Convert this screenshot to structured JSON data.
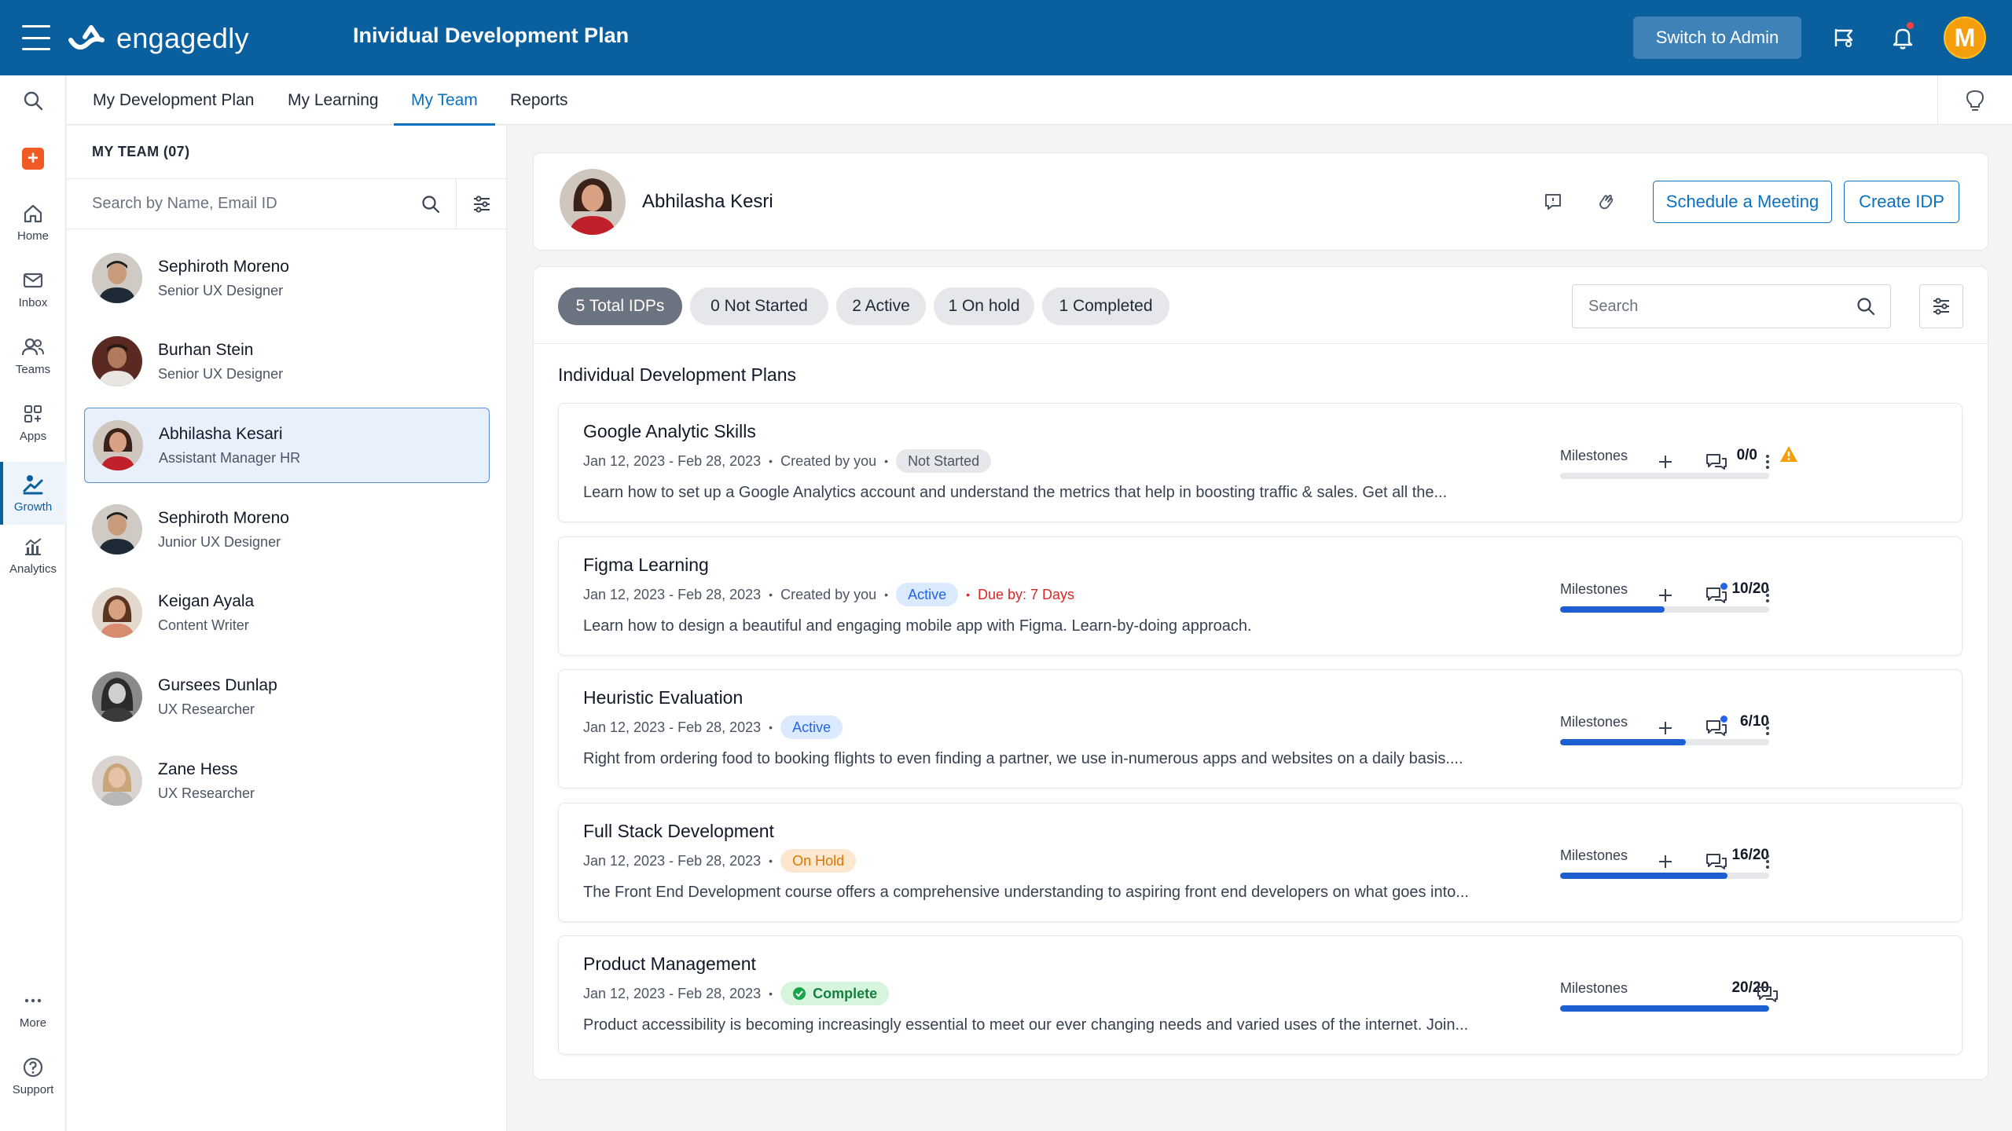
{
  "app": {
    "brand": "engagedly",
    "title": "Inividual Development Plan",
    "switch_admin": "Switch to Admin",
    "user_initial": "M"
  },
  "rail": {
    "items": [
      {
        "label": "Home"
      },
      {
        "label": "Inbox"
      },
      {
        "label": "Teams"
      },
      {
        "label": "Apps"
      },
      {
        "label": "Growth"
      },
      {
        "label": "Analytics"
      },
      {
        "label": "More"
      },
      {
        "label": "Support"
      }
    ]
  },
  "tabs": [
    {
      "label": "My Development Plan"
    },
    {
      "label": "My Learning"
    },
    {
      "label": "My Team"
    },
    {
      "label": "Reports"
    }
  ],
  "team": {
    "header": "MY TEAM (07)",
    "search_placeholder": "Search by Name, Email ID",
    "members": [
      {
        "name": "Sephiroth Moreno",
        "role": "Senior UX Designer"
      },
      {
        "name": "Burhan Stein",
        "role": "Senior UX Designer"
      },
      {
        "name": "Abhilasha Kesari",
        "role": "Assistant Manager HR"
      },
      {
        "name": "Sephiroth Moreno",
        "role": "Junior UX Designer"
      },
      {
        "name": "Keigan Ayala",
        "role": "Content Writer"
      },
      {
        "name": "Gursees Dunlap",
        "role": "UX Researcher"
      },
      {
        "name": "Zane Hess",
        "role": "UX Researcher"
      }
    ]
  },
  "person": {
    "name": "Abhilasha Kesri",
    "schedule_label": "Schedule a Meeting",
    "create_label": "Create IDP"
  },
  "filters": {
    "chips": [
      {
        "label": "5 Total IDPs"
      },
      {
        "label": "0 Not Started"
      },
      {
        "label": "2 Active"
      },
      {
        "label": "1 On hold"
      },
      {
        "label": "1 Completed"
      }
    ],
    "search_placeholder": "Search"
  },
  "plans_title": "Individual Development Plans",
  "plans": [
    {
      "title": "Google Analytic Skills",
      "dates": "Jan 12, 2023 - Feb 28, 2023",
      "created": "Created by you",
      "status": "Not Started",
      "due": "",
      "desc": "Learn how to set up a Google Analytics account and understand the metrics that help in boosting traffic & sales. Get all the...",
      "milestones_label": "Milestones",
      "milestones": "0/0",
      "progress": 0
    },
    {
      "title": "Figma Learning",
      "dates": "Jan 12, 2023 - Feb 28, 2023",
      "created": "Created by you",
      "status": "Active",
      "due": "Due by: 7 Days",
      "desc": "Learn how to design a beautiful and engaging mobile app with Figma. Learn-by-doing approach.",
      "milestones_label": "Milestones",
      "milestones": "10/20",
      "progress": 0.5
    },
    {
      "title": "Heuristic Evaluation",
      "dates": "Jan 12, 2023 - Feb 28, 2023",
      "created": "",
      "status": "Active",
      "due": "",
      "desc": "Right from ordering food to booking flights to even finding a partner, we use in-numerous apps and websites on a daily basis....",
      "milestones_label": "Milestones",
      "milestones": "6/10",
      "progress": 0.6
    },
    {
      "title": "Full Stack Development",
      "dates": "Jan 12, 2023 - Feb 28, 2023",
      "created": "",
      "status": "On Hold",
      "due": "",
      "desc": "The Front End Development course offers a comprehensive understanding to aspiring front end developers on what goes into...",
      "milestones_label": "Milestones",
      "milestones": "16/20",
      "progress": 0.8
    },
    {
      "title": "Product Management",
      "dates": "Jan 12, 2023 - Feb 28, 2023",
      "created": "",
      "status": "Complete",
      "due": "",
      "desc": "Product accessibility is becoming increasingly essential to meet our ever changing needs and varied uses of the internet. Join...",
      "milestones_label": "Milestones",
      "milestones": "20/20",
      "progress": 1.0
    }
  ],
  "colors": {
    "brand": "#0a5f9e",
    "link": "#0a70c0",
    "progress": "#1d5fd0",
    "warning": "#f59e0b",
    "due": "#dc2626"
  }
}
